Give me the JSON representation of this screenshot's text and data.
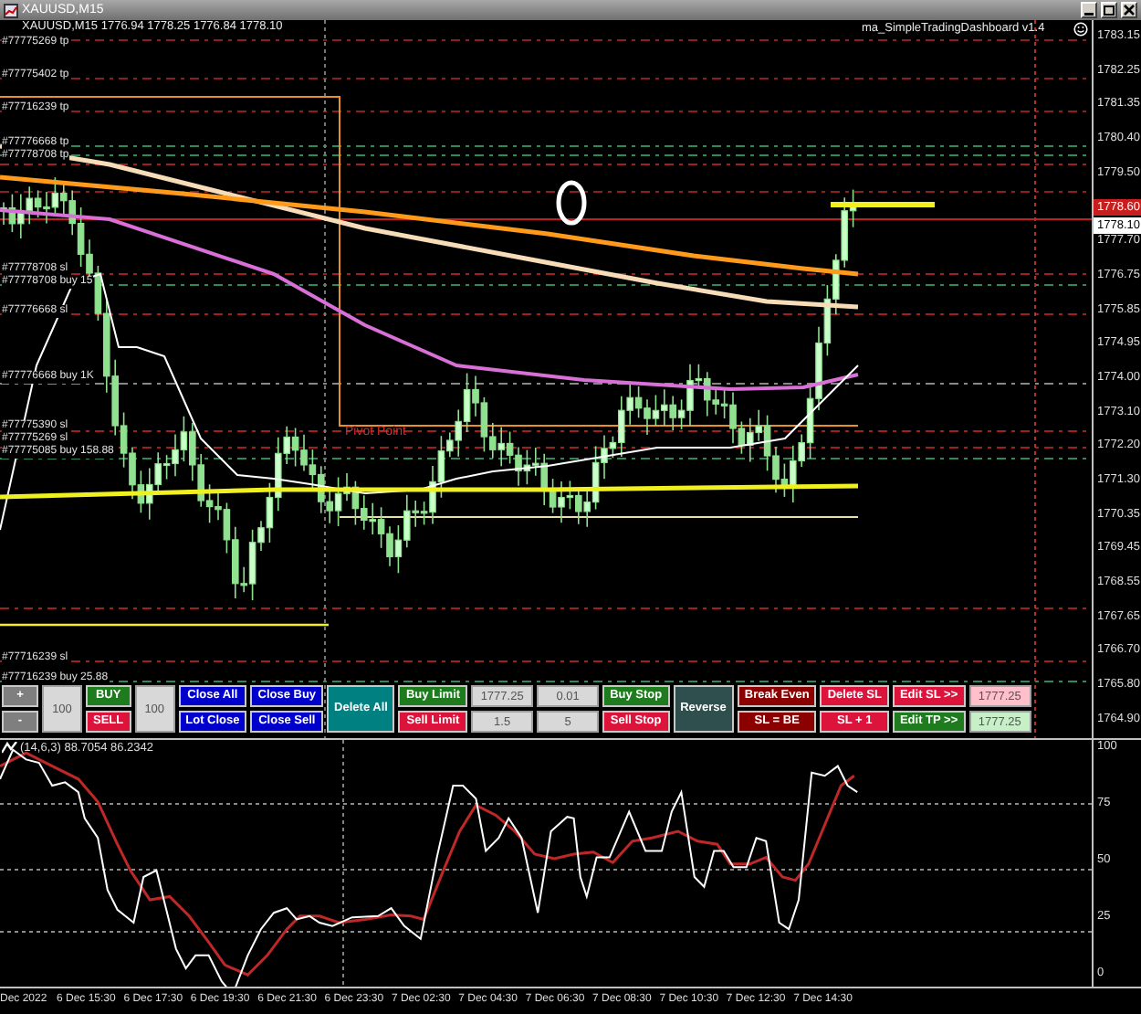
{
  "window": {
    "title": "XAUUSD,M15"
  },
  "chart": {
    "symbol_info": "XAUUSD,M15  1776.94 1778.25 1776.84 1778.10",
    "dashboard_label": "ma_SimpleTradingDashboard v1.4",
    "pivot_label": "Pivot Point",
    "order_labels": [
      {
        "text": "#77775269 tp"
      },
      {
        "text": "#77775402 tp"
      },
      {
        "text": "#77716239 tp"
      },
      {
        "text": "#77776668 tp"
      },
      {
        "text": "#77778708 tp"
      },
      {
        "text": "#77778708 sl"
      },
      {
        "text": "#77778708 buy 15"
      },
      {
        "text": "#77776668 sl"
      },
      {
        "text": "#77776668 buy 1K"
      },
      {
        "text": "#77775390 sl"
      },
      {
        "text": "#77775269 sl"
      },
      {
        "text": "#77775085 buy 158.88"
      },
      {
        "text": "#77716239 sl"
      },
      {
        "text": "#77716239 buy 25.88"
      }
    ],
    "price_axis": [
      {
        "text": "1783.15",
        "highlighted": false
      },
      {
        "text": "1782.25",
        "highlighted": false
      },
      {
        "text": "1781.35",
        "highlighted": false
      },
      {
        "text": "1780.40",
        "highlighted": false
      },
      {
        "text": "1779.50",
        "highlighted": false
      },
      {
        "text": "1778.60",
        "highlighted": true
      },
      {
        "text": "1777.70",
        "highlighted": false
      },
      {
        "text": "1776.75",
        "highlighted": false
      },
      {
        "text": "1775.85",
        "highlighted": false
      },
      {
        "text": "1774.95",
        "highlighted": false
      },
      {
        "text": "1774.00",
        "highlighted": false
      },
      {
        "text": "1773.10",
        "highlighted": false
      },
      {
        "text": "1772.20",
        "highlighted": false
      },
      {
        "text": "1771.30",
        "highlighted": false
      },
      {
        "text": "1770.35",
        "highlighted": false
      },
      {
        "text": "1769.45",
        "highlighted": false
      },
      {
        "text": "1768.55",
        "highlighted": false
      },
      {
        "text": "1767.65",
        "highlighted": false
      },
      {
        "text": "1766.70",
        "highlighted": false
      },
      {
        "text": "1765.80",
        "highlighted": false
      },
      {
        "text": "1764.90",
        "highlighted": false
      }
    ],
    "price_marker": "1778.10"
  },
  "dashboard": {
    "columns": [
      [
        {
          "kind": "button",
          "label": "+",
          "color": "#7f7f7f"
        },
        {
          "kind": "button",
          "label": "-",
          "color": "#7f7f7f"
        }
      ],
      [
        {
          "kind": "field",
          "value": "100"
        }
      ],
      [
        {
          "kind": "button",
          "label": "BUY",
          "color": "#1e7b1e"
        },
        {
          "kind": "button",
          "label": "SELL",
          "color": "#dc143c"
        }
      ],
      [
        {
          "kind": "field",
          "value": "100"
        }
      ],
      [
        {
          "kind": "button",
          "label": "Close All",
          "color": "#0000cd"
        },
        {
          "kind": "button",
          "label": "Lot Close",
          "color": "#0000cd"
        }
      ],
      [
        {
          "kind": "button",
          "label": "Close Buy",
          "color": "#0000cd"
        },
        {
          "kind": "button",
          "label": "Close Sell",
          "color": "#0000cd"
        }
      ],
      [
        {
          "kind": "button",
          "label": "Delete All",
          "color": "#008080"
        }
      ],
      [
        {
          "kind": "button",
          "label": "Buy Limit",
          "color": "#1e7b1e"
        },
        {
          "kind": "button",
          "label": "Sell Limit",
          "color": "#dc143c"
        }
      ],
      [
        {
          "kind": "field",
          "value": "1777.25"
        },
        {
          "kind": "field",
          "value": "1.5"
        }
      ],
      [
        {
          "kind": "field",
          "value": "0.01"
        },
        {
          "kind": "field",
          "value": "5"
        }
      ],
      [
        {
          "kind": "button",
          "label": "Buy Stop",
          "color": "#1e7b1e"
        },
        {
          "kind": "button",
          "label": "Sell Stop",
          "color": "#dc143c"
        }
      ],
      [
        {
          "kind": "button",
          "label": "Reverse",
          "color": "#2f4f4f"
        }
      ],
      [
        {
          "kind": "button",
          "label": "Break Even",
          "color": "#8b0000"
        },
        {
          "kind": "button",
          "label": "SL = BE",
          "color": "#8b0000"
        }
      ],
      [
        {
          "kind": "button",
          "label": "Delete SL",
          "color": "#dc143c"
        },
        {
          "kind": "button",
          "label": "SL + 1",
          "color": "#dc143c"
        }
      ],
      [
        {
          "kind": "button",
          "label": "Edit SL >>",
          "color": "#dc143c"
        },
        {
          "kind": "button",
          "label": "Edit TP >>",
          "color": "#1e7b1e"
        }
      ],
      [
        {
          "kind": "field",
          "value": "1777.25",
          "color": "#ffc0cb"
        },
        {
          "kind": "field",
          "value": "1777.25",
          "color": "#c8f0c8"
        }
      ]
    ]
  },
  "oscillator": {
    "label": "(14,6,3) 88.7054 86.2342",
    "axis": [
      "100",
      "75",
      "50",
      "25",
      "0"
    ]
  },
  "time_axis": [
    "Dec 2022",
    "6 Dec 15:30",
    "6 Dec 17:30",
    "6 Dec 19:30",
    "6 Dec 21:30",
    "6 Dec 23:30",
    "7 Dec 02:30",
    "7 Dec 04:30",
    "7 Dec 06:30",
    "7 Dec 08:30",
    "7 Dec 10:30",
    "7 Dec 12:30",
    "7 Dec 14:30"
  ]
}
